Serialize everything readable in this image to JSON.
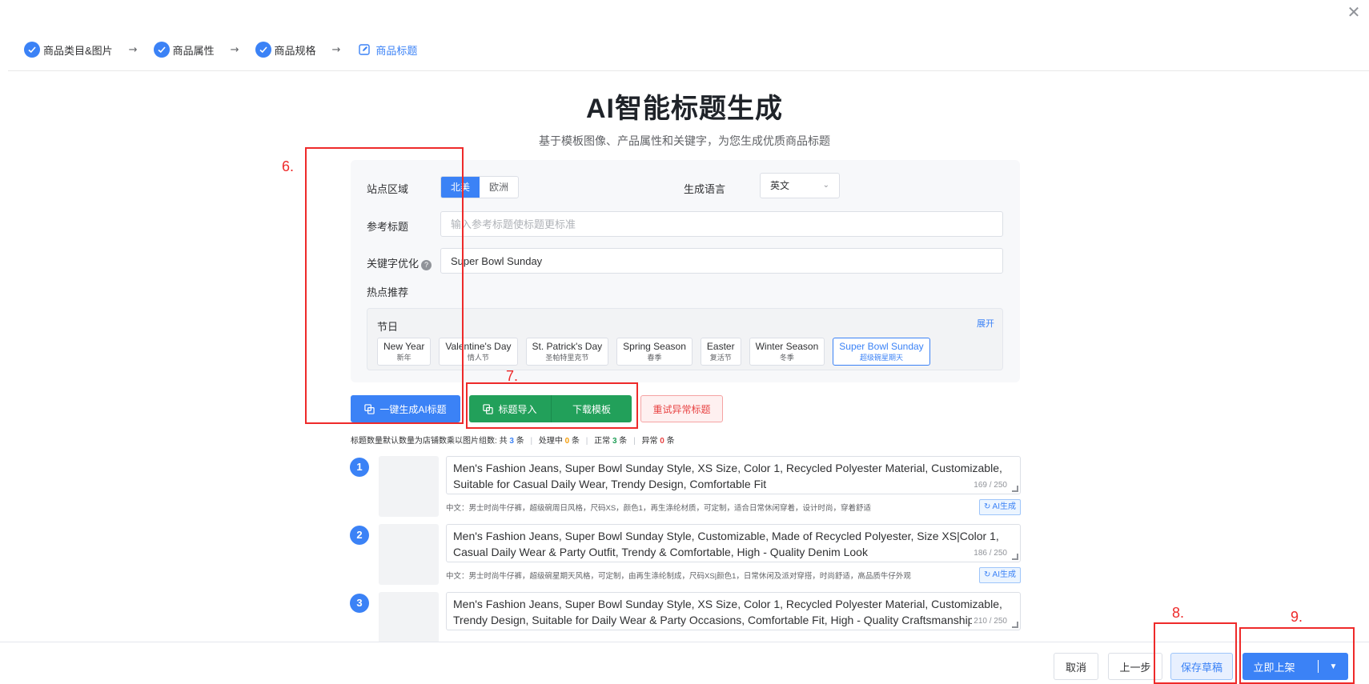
{
  "window": {
    "close_glyph": "✕"
  },
  "steps": [
    {
      "label": "商品类目&图片",
      "state": "done"
    },
    {
      "label": "商品属性",
      "state": "done"
    },
    {
      "label": "商品规格",
      "state": "done"
    },
    {
      "label": "商品标题",
      "state": "active"
    }
  ],
  "step_arrow": "→",
  "page": {
    "title": "AI智能标题生成",
    "subtitle": "基于模板图像、产品属性和关键字，为您生成优质商品标题"
  },
  "form": {
    "region_label": "站点区域",
    "region_options": [
      "北美",
      "欧洲"
    ],
    "region_selected": "北美",
    "language_label": "生成语言",
    "language_value": "英文",
    "ref_title_label": "参考标题",
    "ref_title_placeholder": "输入参考标题使标题更标准",
    "keyword_label": "关键字优化",
    "keyword_help": "?",
    "keyword_value": "Super Bowl Sunday",
    "hot_label": "热点推荐",
    "hot_category": "节日",
    "hot_expand": "展开",
    "hot_tags": [
      {
        "en": "New Year",
        "cn": "新年"
      },
      {
        "en": "Valentine's Day",
        "cn": "情人节"
      },
      {
        "en": "St. Patrick's Day",
        "cn": "圣帕特里克节"
      },
      {
        "en": "Spring Season",
        "cn": "春季"
      },
      {
        "en": "Easter",
        "cn": "复活节"
      },
      {
        "en": "Winter Season",
        "cn": "冬季"
      },
      {
        "en": "Super Bowl Sunday",
        "cn": "超级碗星期天"
      }
    ],
    "hot_selected": "Super Bowl Sunday"
  },
  "actions": {
    "generate": "一键生成AI标题",
    "import": "标题导入",
    "download": "下载模板",
    "retry": "重试异常标题"
  },
  "stats": {
    "hint": "标题数量默认数量为店铺数乘以图片组数:",
    "total_label": "共",
    "total": "3",
    "total_unit": "条",
    "processing_label": "处理中",
    "processing": "0",
    "processing_unit": "条",
    "normal_label": "正常",
    "normal": "3",
    "normal_unit": "条",
    "error_label": "异常",
    "error": "0",
    "error_unit": "条"
  },
  "items": [
    {
      "index": "1",
      "title": "Men's Fashion Jeans, Super Bowl Sunday Style, XS Size, Color 1, Recycled Polyester Material, Customizable, Suitable for Casual Daily Wear, Trendy Design, Comfortable Fit",
      "count": "169 / 250",
      "cn": "中文：男士时尚牛仔裤，超级碗周日风格，尺码XS，颜色1，再生涤纶材质，可定制，适合日常休闲穿着，设计时尚，穿着舒适",
      "ai_btn": "AI生成"
    },
    {
      "index": "2",
      "title": "Men's Fashion Jeans, Super Bowl Sunday Style, Customizable, Made of Recycled Polyester, Size XS|Color 1, Casual Daily Wear & Party Outfit, Trendy & Comfortable, High - Quality Denim Look",
      "count": "186 / 250",
      "cn": "中文：男士时尚牛仔裤，超级碗星期天风格，可定制，由再生涤纶制成，尺码XS|颜色1，日常休闲及派对穿搭，时尚舒适，高品质牛仔外观",
      "ai_btn": "AI生成"
    },
    {
      "index": "3",
      "title": "Men's Fashion Jeans, Super Bowl Sunday Style, XS Size, Color 1, Recycled Polyester Material, Customizable, Trendy Design, Suitable for Daily Wear & Party Occasions, Comfortable Fit, High - Quality Craftsmanship",
      "count": "210 / 250",
      "cn": "",
      "ai_btn": ""
    }
  ],
  "footer": {
    "cancel": "取消",
    "prev": "上一步",
    "save_draft": "保存草稿",
    "publish": "立即上架",
    "publish_caret": "▼"
  },
  "annotations": [
    {
      "label": "6."
    },
    {
      "label": "7."
    },
    {
      "label": "8."
    },
    {
      "label": "9."
    }
  ],
  "colors": {
    "primary": "#3b82f6",
    "green": "#22a05a",
    "danger": "#e84343",
    "annotation": "#ee2a2a"
  }
}
